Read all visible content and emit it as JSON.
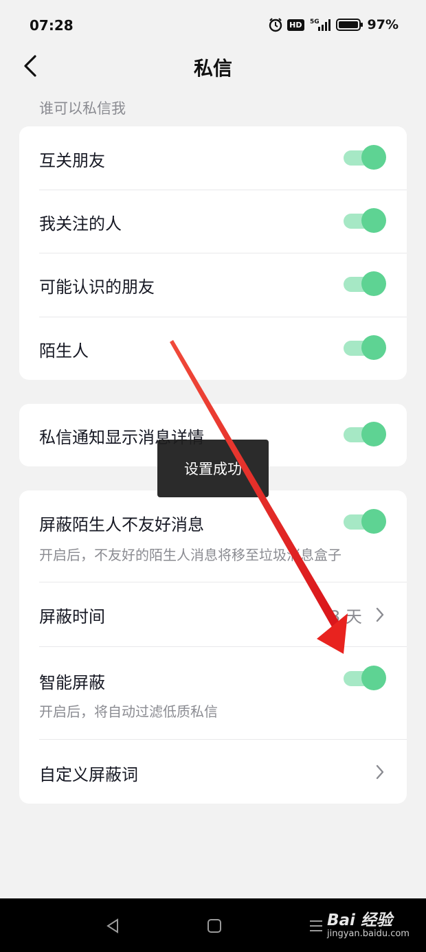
{
  "status_bar": {
    "time": "07:28",
    "hd": "HD",
    "network": "5G",
    "battery": "97%"
  },
  "header": {
    "title": "私信",
    "back_icon": "chevron-left-icon"
  },
  "section_label": "谁可以私信我",
  "who_can_message": [
    {
      "label": "互关朋友",
      "enabled": true
    },
    {
      "label": "我关注的人",
      "enabled": true
    },
    {
      "label": "可能认识的朋友",
      "enabled": true
    },
    {
      "label": "陌生人",
      "enabled": true
    }
  ],
  "notification": {
    "label": "私信通知显示消息详情",
    "enabled": true
  },
  "filter": {
    "block_unfriendly": {
      "label": "屏蔽陌生人不友好消息",
      "description": "开启后，不友好的陌生人消息将移至垃圾消息盒子",
      "enabled": true
    },
    "block_time": {
      "label": "屏蔽时间",
      "value": "3 天"
    },
    "smart_block": {
      "label": "智能屏蔽",
      "description": "开启后，将自动过滤低质私信",
      "enabled": true
    },
    "custom_words": {
      "label": "自定义屏蔽词"
    }
  },
  "toast": "设置成功",
  "colors": {
    "toggle_on_knob": "#5ed393",
    "toggle_on_track": "#a6e8c5",
    "annotation_arrow": "#e8231f",
    "background": "#f2f2f2"
  },
  "watermark": {
    "logo": "Bai 经验",
    "url": "jingyan.baidu.com"
  }
}
